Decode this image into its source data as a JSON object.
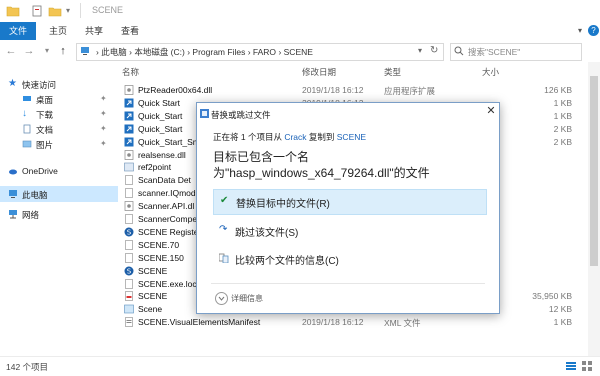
{
  "window": {
    "title": "SCENE"
  },
  "ribbon": {
    "tabs": [
      "文件",
      "主页",
      "共享",
      "查看"
    ]
  },
  "address": {
    "crumbs": [
      "此电脑",
      "本地磁盘 (C:)",
      "Program Files",
      "FARO",
      "SCENE"
    ],
    "search_placeholder": "搜索\"SCENE\""
  },
  "nav": {
    "items": [
      {
        "label": "快速访问",
        "icon": "star-icon"
      },
      {
        "label": "桌面",
        "icon": "desktop-icon",
        "pinned": true
      },
      {
        "label": "下载",
        "icon": "download-icon",
        "pinned": true
      },
      {
        "label": "文档",
        "icon": "document-icon",
        "pinned": true
      },
      {
        "label": "图片",
        "icon": "picture-icon",
        "pinned": true
      },
      {
        "label": "OneDrive",
        "icon": "cloud-icon"
      },
      {
        "label": "此电脑",
        "icon": "computer-icon",
        "selected": true
      },
      {
        "label": "网络",
        "icon": "network-icon"
      }
    ]
  },
  "columns": {
    "name": "名称",
    "date": "修改日期",
    "type": "类型",
    "size": "大小"
  },
  "files": [
    {
      "name": "PtzReader00x64.dll",
      "date": "2019/1/18 16:12",
      "type": "应用程序扩展",
      "size": "126 KB",
      "icon": "dll-icon"
    },
    {
      "name": "Quick Start",
      "date": "2019/1/18 16:12",
      "type": "",
      "size": "1 KB",
      "icon": "shortcut-icon"
    },
    {
      "name": "Quick_Start",
      "date": "",
      "type": "",
      "size": "1 KB",
      "icon": "shortcut-icon"
    },
    {
      "name": "Quick_Start",
      "date": "",
      "type": "",
      "size": "2 KB",
      "icon": "shortcut-icon"
    },
    {
      "name": "Quick_Start_Sm",
      "date": "",
      "type": "",
      "size": "2 KB",
      "icon": "shortcut-icon"
    },
    {
      "name": "realsense.dll",
      "date": "",
      "type": "",
      "size": "",
      "icon": "dll-icon"
    },
    {
      "name": "ref2point",
      "date": "",
      "type": "",
      "size": "",
      "icon": "app-icon"
    },
    {
      "name": "ScanData Det",
      "date": "",
      "type": "",
      "size": "",
      "icon": "file-icon"
    },
    {
      "name": "scanner.IQmod",
      "date": "",
      "type": "",
      "size": "",
      "icon": "file-icon"
    },
    {
      "name": "Scanner.API.dl",
      "date": "",
      "type": "",
      "size": "",
      "icon": "dll-icon"
    },
    {
      "name": "ScannerCompe",
      "date": "",
      "type": "",
      "size": "",
      "icon": "file-icon"
    },
    {
      "name": "SCENE Registe",
      "date": "",
      "type": "",
      "size": "",
      "icon": "scene-icon"
    },
    {
      "name": "SCENE.70",
      "date": "",
      "type": "",
      "size": "",
      "icon": "file-icon"
    },
    {
      "name": "SCENE.150",
      "date": "",
      "type": "",
      "size": "",
      "icon": "file-icon"
    },
    {
      "name": "SCENE",
      "date": "",
      "type": "",
      "size": "",
      "icon": "scene-icon"
    },
    {
      "name": "SCENE.exe.loca",
      "date": "",
      "type": "",
      "size": "",
      "icon": "file-icon"
    },
    {
      "name": "SCENE",
      "date": "2018/11/21 15:22",
      "type": "PDF 文件",
      "size": "35,950 KB",
      "icon": "pdf-icon"
    },
    {
      "name": "Scene",
      "date": "2019/1/18 16:12",
      "type": "PNG 文件",
      "size": "12 KB",
      "icon": "png-icon"
    },
    {
      "name": "SCENE.VisualElementsManifest",
      "date": "2019/1/18 16:12",
      "type": "XML 文件",
      "size": "1 KB",
      "icon": "xml-icon"
    }
  ],
  "status": {
    "count": "142 个项目"
  },
  "dialog": {
    "title": "替换或跳过文件",
    "line1_pre": "正在将 1 个项目从 ",
    "line1_src": "Crack",
    "line1_mid": " 复制到 ",
    "line1_dst": "SCENE",
    "message": "目标已包含一个名为\"hasp_windows_x64_79264.dll\"的文件",
    "options": [
      {
        "label": "替换目标中的文件(R)",
        "icon": "check-icon"
      },
      {
        "label": "跳过该文件(S)",
        "icon": "skip-icon"
      },
      {
        "label": "比较两个文件的信息(C)",
        "icon": "compare-icon"
      }
    ],
    "details": "详细信息"
  },
  "colors": {
    "accent": "#1979ca",
    "selection": "#cce8ff",
    "dialog_border": "#7a9ec7",
    "option_hover": "#dbeefb"
  }
}
